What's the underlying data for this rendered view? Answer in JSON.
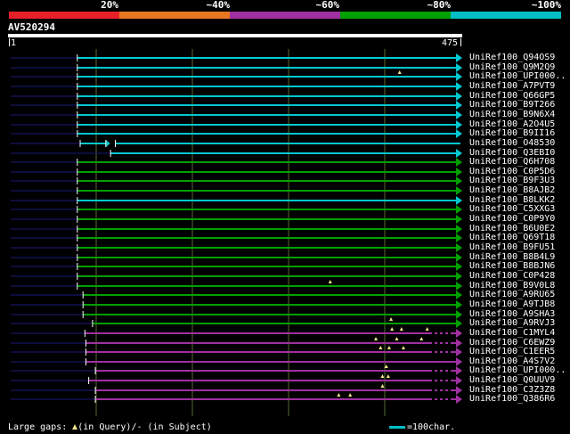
{
  "legend": [
    {
      "label": "20%",
      "color": "#e8202a"
    },
    {
      "label": "~40%",
      "color": "#e87722"
    },
    {
      "label": "~60%",
      "color": "#a030a0"
    },
    {
      "label": "~80%",
      "color": "#00a000"
    },
    {
      "label": "~100%",
      "color": "#00bfc4"
    }
  ],
  "query": {
    "id": "AV520294",
    "start": "1",
    "end": "475",
    "length": 475
  },
  "colors": {
    "cyan": "#00c8d0",
    "green": "#00a000",
    "purple": "#a030a0",
    "navy": "#1a1a7a",
    "gap": "#f0e68c",
    "grid": "#556b2f"
  },
  "rows": [
    {
      "name": "UniRef100_Q94OS9",
      "c": "cyan",
      "s": 72,
      "e": 475,
      "d": 0,
      "gaps": [],
      "m": [
        72
      ]
    },
    {
      "name": "UniRef100_Q9M2Q9",
      "c": "cyan",
      "s": 72,
      "e": 475,
      "d": 0,
      "gaps": [],
      "m": [
        72
      ]
    },
    {
      "name": "UniRef100_UPI000..",
      "c": "cyan",
      "s": 72,
      "e": 475,
      "d": 0,
      "gaps": [
        411
      ],
      "m": [
        72
      ]
    },
    {
      "name": "UniRef100_A7PVT9",
      "c": "cyan",
      "s": 72,
      "e": 475,
      "d": 0,
      "gaps": [],
      "m": [
        72
      ]
    },
    {
      "name": "UniRef100_Q66GP5",
      "c": "cyan",
      "s": 72,
      "e": 475,
      "d": 0,
      "gaps": [],
      "m": [
        72
      ]
    },
    {
      "name": "UniRef100_B9T266",
      "c": "cyan",
      "s": 72,
      "e": 475,
      "d": 0,
      "gaps": [],
      "m": [
        72
      ]
    },
    {
      "name": "UniRef100_B9N6X4",
      "c": "cyan",
      "s": 72,
      "e": 475,
      "d": 0,
      "gaps": [],
      "m": [
        72
      ]
    },
    {
      "name": "UniRef100_A2O4U5",
      "c": "cyan",
      "s": 72,
      "e": 475,
      "d": 0,
      "gaps": [],
      "m": [
        72
      ]
    },
    {
      "name": "UniRef100_B9II16",
      "c": "cyan",
      "s": 72,
      "e": 475,
      "d": 0,
      "gaps": [],
      "m": [
        72
      ]
    },
    {
      "name": "UniRef100_O48530",
      "c": "cyan",
      "s": 75,
      "e": 475,
      "d": 0,
      "gaps": [],
      "m": [
        75,
        102,
        112
      ],
      "short": [
        75,
        102
      ]
    },
    {
      "name": "UniRef100_Q3EBI0",
      "c": "cyan",
      "s": 107,
      "e": 475,
      "d": 0,
      "gaps": [],
      "m": [
        107
      ]
    },
    {
      "name": "UniRef100_Q6H708",
      "c": "green",
      "s": 72,
      "e": 475,
      "d": 0,
      "gaps": [],
      "m": [
        72
      ]
    },
    {
      "name": "UniRef100_C0P5D6",
      "c": "green",
      "s": 72,
      "e": 475,
      "d": 0,
      "gaps": [],
      "m": [
        72
      ]
    },
    {
      "name": "UniRef100_B9F3U3",
      "c": "green",
      "s": 72,
      "e": 475,
      "d": 0,
      "gaps": [],
      "m": [
        72
      ]
    },
    {
      "name": "UniRef100_B8AJB2",
      "c": "green",
      "s": 72,
      "e": 475,
      "d": 0,
      "gaps": [],
      "m": [
        72
      ]
    },
    {
      "name": "UniRef100_B8LKK2",
      "c": "cyan",
      "s": 72,
      "e": 475,
      "d": 0,
      "gaps": [],
      "m": [
        72
      ]
    },
    {
      "name": "UniRef100_C5XXG3",
      "c": "green",
      "s": 72,
      "e": 475,
      "d": 0,
      "gaps": [],
      "m": [
        72
      ]
    },
    {
      "name": "UniRef100_C0P9Y0",
      "c": "green",
      "s": 72,
      "e": 475,
      "d": 0,
      "gaps": [],
      "m": [
        72
      ]
    },
    {
      "name": "UniRef100_B6U0E2",
      "c": "green",
      "s": 72,
      "e": 475,
      "d": 0,
      "gaps": [],
      "m": [
        72
      ]
    },
    {
      "name": "UniRef100_Q69T18",
      "c": "green",
      "s": 72,
      "e": 475,
      "d": 0,
      "gaps": [],
      "m": [
        72
      ]
    },
    {
      "name": "UniRef100_B9FU51",
      "c": "green",
      "s": 72,
      "e": 475,
      "d": 0,
      "gaps": [],
      "m": [
        72
      ]
    },
    {
      "name": "UniRef100_B8B4L9",
      "c": "green",
      "s": 72,
      "e": 475,
      "d": 0,
      "gaps": [],
      "m": [
        72
      ]
    },
    {
      "name": "UniRef100_B8BJN6",
      "c": "green",
      "s": 72,
      "e": 475,
      "d": 0,
      "gaps": [],
      "m": [
        72
      ]
    },
    {
      "name": "UniRef100_C0P428",
      "c": "green",
      "s": 72,
      "e": 475,
      "d": 0,
      "gaps": [],
      "m": [
        72
      ]
    },
    {
      "name": "UniRef100_B9V0L8",
      "c": "green",
      "s": 72,
      "e": 475,
      "d": 0,
      "gaps": [
        338
      ],
      "m": [
        72
      ]
    },
    {
      "name": "UniRef100_A9RU65",
      "c": "green",
      "s": 78,
      "e": 475,
      "d": 0,
      "gaps": [],
      "m": [
        78
      ]
    },
    {
      "name": "UniRef100_A9TJB8",
      "c": "green",
      "s": 78,
      "e": 475,
      "d": 0,
      "gaps": [],
      "m": [
        78
      ]
    },
    {
      "name": "UniRef100_A9SHA3",
      "c": "green",
      "s": 78,
      "e": 475,
      "d": 0,
      "gaps": [],
      "m": [
        78
      ]
    },
    {
      "name": "UniRef100_A9RVJ3",
      "c": "green",
      "s": 88,
      "e": 475,
      "d": 0,
      "gaps": [
        402
      ],
      "m": [
        88
      ]
    },
    {
      "name": "UniRef100_C1MYL4",
      "c": "purple",
      "s": 80,
      "e": 475,
      "d": 1,
      "gaps": [
        403,
        413,
        440
      ],
      "m": [
        80
      ]
    },
    {
      "name": "UniRef100_C6EWZ9",
      "c": "purple",
      "s": 81,
      "e": 475,
      "d": 1,
      "gaps": [
        386,
        408,
        434
      ],
      "m": [
        81
      ]
    },
    {
      "name": "UniRef100_C1EER5",
      "c": "purple",
      "s": 81,
      "e": 475,
      "d": 1,
      "gaps": [
        391,
        400,
        415
      ],
      "m": [
        81
      ]
    },
    {
      "name": "UniRef100_A4S7V2",
      "c": "purple",
      "s": 81,
      "e": 475,
      "d": 1,
      "gaps": [],
      "m": [
        81
      ]
    },
    {
      "name": "UniRef100_UPI000..",
      "c": "purple",
      "s": 91,
      "e": 475,
      "d": 1,
      "gaps": [
        397
      ],
      "m": [
        91
      ]
    },
    {
      "name": "UniRef100_Q0UUV9",
      "c": "purple",
      "s": 84,
      "e": 475,
      "d": 1,
      "gaps": [
        393,
        399
      ],
      "m": [
        84
      ]
    },
    {
      "name": "UniRef100_C3Z3Z8",
      "c": "purple",
      "s": 91,
      "e": 475,
      "d": 1,
      "gaps": [
        393
      ],
      "m": [
        91
      ]
    },
    {
      "name": "UniRef100_Q386R6",
      "c": "purple",
      "s": 91,
      "e": 475,
      "d": 1,
      "gaps": [
        347,
        359
      ],
      "m": [
        91
      ]
    }
  ],
  "footer": {
    "left_prefix": "Large gaps: ",
    "left_mid": "(in Query)/- (in Subject)",
    "right": "=100char."
  }
}
